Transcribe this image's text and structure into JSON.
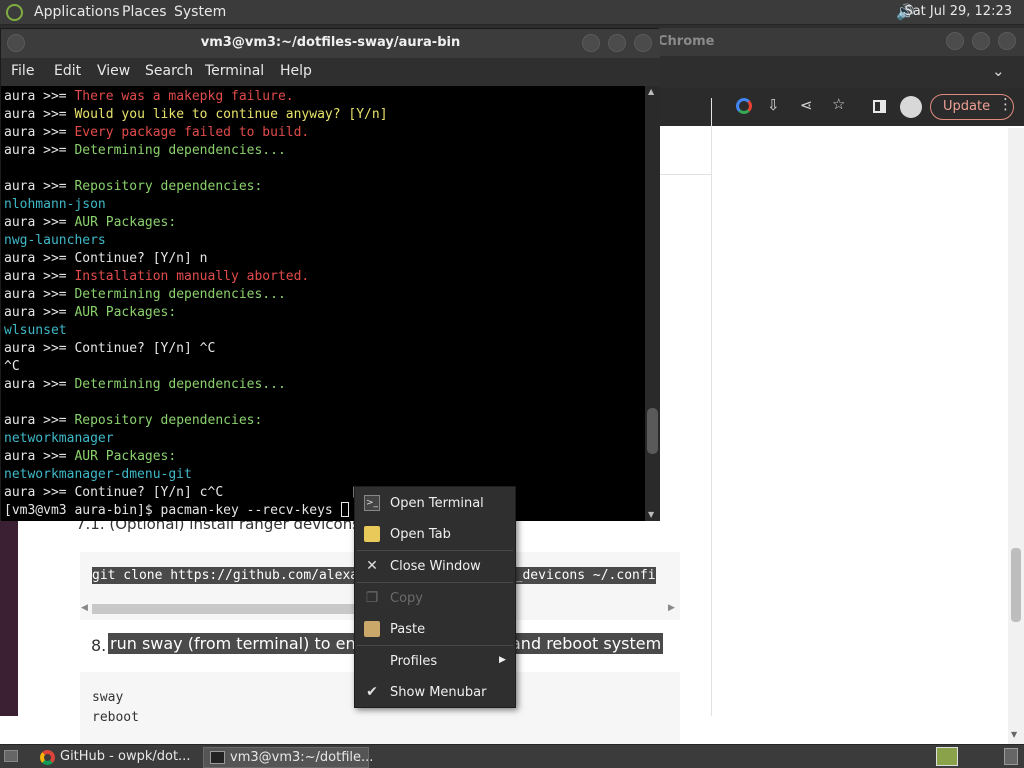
{
  "top_panel": {
    "menus": [
      "Applications",
      "Places",
      "System"
    ],
    "clock": "Sat Jul 29, 12:23"
  },
  "chrome": {
    "title_fragment": "Chrome",
    "update_label": "Update"
  },
  "page": {
    "step_71": "7.1. (Optional) install ranger devicons",
    "code1": "git clone https://github.com/alexanderjeurissen/ranger_devicons ~/.confi",
    "step_8_num": "8.",
    "step_8_a": "run sway (from terminal) to ensu",
    "step_8_b": "and reboot system",
    "code2": [
      "sway",
      "reboot"
    ]
  },
  "terminal": {
    "title": "vm3@vm3:~/dotfiles-sway/aura-bin",
    "menu": [
      "File",
      "Edit",
      "View",
      "Search",
      "Terminal",
      "Help"
    ],
    "lines": [
      [
        {
          "t": "aura >>= ",
          "c": "w"
        },
        {
          "t": "There was a makepkg failure.",
          "c": "r"
        }
      ],
      [
        {
          "t": "aura >>= ",
          "c": "w"
        },
        {
          "t": "Would you like to continue anyway? [Y/n]",
          "c": "y"
        }
      ],
      [
        {
          "t": "aura >>= ",
          "c": "w"
        },
        {
          "t": "Every package failed to build.",
          "c": "r"
        }
      ],
      [
        {
          "t": "aura >>= ",
          "c": "w"
        },
        {
          "t": "Determining dependencies...",
          "c": "g"
        }
      ],
      [
        {
          "t": "",
          "c": "w"
        }
      ],
      [
        {
          "t": "aura >>= ",
          "c": "w"
        },
        {
          "t": "Repository dependencies:",
          "c": "g"
        }
      ],
      [
        {
          "t": "nlohmann-json",
          "c": "c"
        }
      ],
      [
        {
          "t": "aura >>= ",
          "c": "w"
        },
        {
          "t": "AUR Packages:",
          "c": "g"
        }
      ],
      [
        {
          "t": "nwg-launchers",
          "c": "c"
        }
      ],
      [
        {
          "t": "aura >>= Continue? [Y/n] n",
          "c": "w"
        }
      ],
      [
        {
          "t": "aura >>= ",
          "c": "w"
        },
        {
          "t": "Installation manually aborted.",
          "c": "r"
        }
      ],
      [
        {
          "t": "aura >>= ",
          "c": "w"
        },
        {
          "t": "Determining dependencies...",
          "c": "g"
        }
      ],
      [
        {
          "t": "aura >>= ",
          "c": "w"
        },
        {
          "t": "AUR Packages:",
          "c": "g"
        }
      ],
      [
        {
          "t": "wlsunset",
          "c": "c"
        }
      ],
      [
        {
          "t": "aura >>= Continue? [Y/n] ^C",
          "c": "w"
        }
      ],
      [
        {
          "t": "^C",
          "c": "w"
        }
      ],
      [
        {
          "t": "aura >>= ",
          "c": "w"
        },
        {
          "t": "Determining dependencies...",
          "c": "g"
        }
      ],
      [
        {
          "t": "",
          "c": "w"
        }
      ],
      [
        {
          "t": "aura >>= ",
          "c": "w"
        },
        {
          "t": "Repository dependencies:",
          "c": "g"
        }
      ],
      [
        {
          "t": "networkmanager",
          "c": "c"
        }
      ],
      [
        {
          "t": "aura >>= ",
          "c": "w"
        },
        {
          "t": "AUR Packages:",
          "c": "g"
        }
      ],
      [
        {
          "t": "networkmanager-dmenu-git",
          "c": "c"
        }
      ],
      [
        {
          "t": "aura >>= Continue? [Y/n] c^C",
          "c": "w"
        }
      ]
    ],
    "prompt": "[vm3@vm3 aura-bin]$ pacman-key --recv-keys "
  },
  "context_menu": {
    "items": [
      {
        "label": "Open Terminal",
        "icon": "terminal-icon",
        "enabled": true
      },
      {
        "label": "Open Tab",
        "icon": "folder-icon",
        "enabled": true
      },
      {
        "label": "Close Window",
        "icon": "close-icon",
        "enabled": true
      },
      {
        "label": "Copy",
        "icon": "copy-icon",
        "enabled": false
      },
      {
        "label": "Paste",
        "icon": "paste-icon",
        "enabled": true
      },
      {
        "label": "Profiles",
        "icon": "",
        "enabled": true,
        "submenu": true
      },
      {
        "label": "Show Menubar",
        "icon": "check-icon",
        "enabled": true,
        "checked": true
      }
    ]
  },
  "taskbar": {
    "tasks": [
      {
        "label": "GitHub - owpk/dot...",
        "icon": "chrome-icon"
      },
      {
        "label": "vm3@vm3:~/dotfile...",
        "icon": "terminal-icon"
      }
    ]
  }
}
